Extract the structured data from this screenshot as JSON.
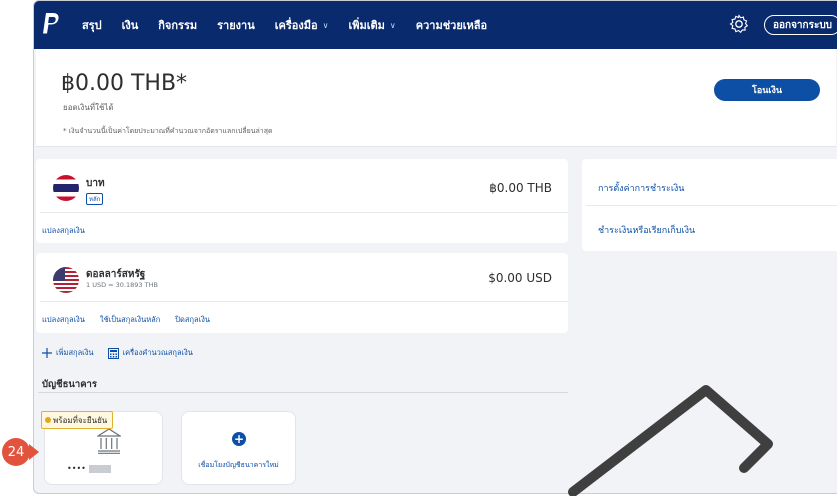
{
  "nav": {
    "items": [
      {
        "label": "สรุป",
        "dropdown": false
      },
      {
        "label": "เงิน",
        "dropdown": false
      },
      {
        "label": "กิจกรรม",
        "dropdown": false
      },
      {
        "label": "รายงาน",
        "dropdown": false
      },
      {
        "label": "เครื่องมือ",
        "dropdown": true
      },
      {
        "label": "เพิ่มเติม",
        "dropdown": true
      },
      {
        "label": "ความช่วยเหลือ",
        "dropdown": false
      }
    ],
    "logout_label": "ออกจากระบบ",
    "icons": {
      "logo": "paypal-logo",
      "settings": "gear-icon",
      "dropdown": "chevron-down-icon"
    }
  },
  "balance": {
    "amount": "฿0.00 THB*",
    "available_label": "ยอดเงินที่ใช้ได้",
    "note": "* เงินจำนวนนี้เป็นค่าโดยประมาณที่คำนวณจากอัตราแลกเปลี่ยนล่าสุด",
    "transfer_label": "โอนเงิน"
  },
  "currencies": [
    {
      "name": "บาท",
      "badge": "หลัก",
      "amount": "฿0.00 THB",
      "links": [
        "แปลงสกุลเงิน"
      ]
    },
    {
      "name": "ดอลลาร์สหรัฐ",
      "rate": "1 USD = 30.1893 THB",
      "amount": "$0.00 USD",
      "links": [
        "แปลงสกุลเงิน",
        "ใช้เป็นสกุลเงินหลัก",
        "ปิดสกุลเงิน"
      ]
    }
  ],
  "side_links": [
    "การตั้งค่าการชำระเงิน",
    "ชำระเงินหรือเรียกเก็บเงิน"
  ],
  "tools": {
    "add_currency": "เพิ่มสกุลเงิน",
    "calculator": "เครื่องคำนวณสกุลเงิน"
  },
  "bank_section": {
    "title": "บัญชีธนาคาร",
    "pending_label": "พร้อมที่จะยืนยัน",
    "bank_number_prefix": "••••",
    "link_new_label": "เชื่อมโยงบัญชีธนาคารใหม่"
  },
  "step_marker": "24",
  "colors": {
    "nav_bg": "#0a2a6e",
    "accent": "#0e4fa6",
    "pending": "#e0b12c",
    "marker": "#e2533e"
  }
}
